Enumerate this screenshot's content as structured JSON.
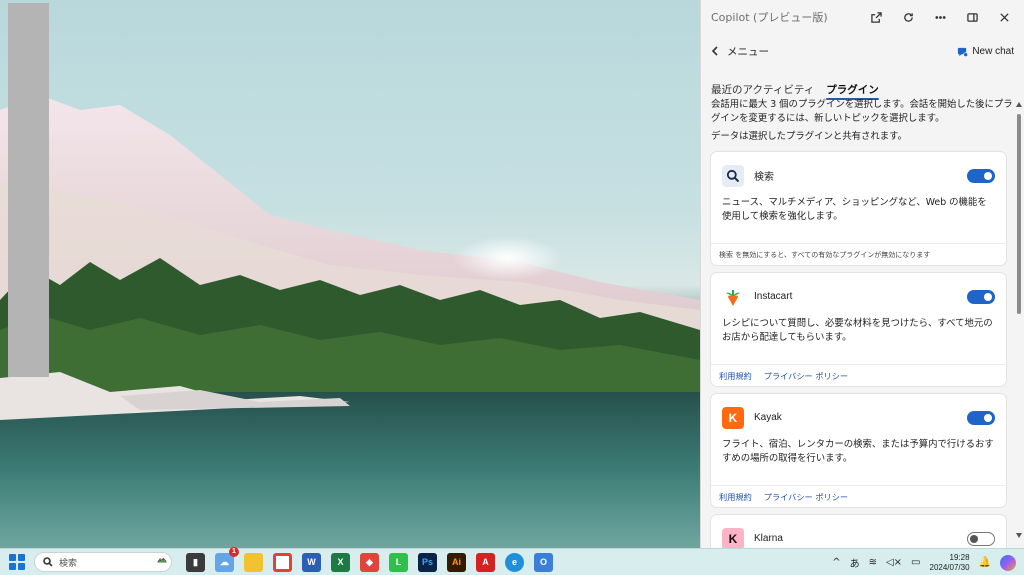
{
  "copilot": {
    "title": "Copilot (プレビュー版)",
    "back_label": "メニュー",
    "new_chat_label": "New chat",
    "tabs": [
      {
        "label": "最近のアクティビティ",
        "active": false
      },
      {
        "label": "プラグイン",
        "active": true
      }
    ],
    "intro": [
      "会話用に最大 3 個のプラグインを選択します。会話を開始した後にプラグインを変更するには、新しいトピックを選択します。",
      "データは選択したプラグインと共有されます。"
    ],
    "plugins": [
      {
        "name": "検索",
        "enabled": true,
        "description": "ニュース、マルチメディア、ショッピングなど、Web の機能を使用して検索を強化します。",
        "footer_note": "検索 を無効にすると、すべての有効なプラグインが無効になります"
      },
      {
        "name": "Instacart",
        "enabled": true,
        "description": "レシピについて質問し、必要な材料を見つけたら、すべて地元のお店から配達してもらいます。",
        "terms_link": "利用規約",
        "privacy_link": "プライバシー ポリシー"
      },
      {
        "name": "Kayak",
        "enabled": true,
        "description": "フライト、宿泊、レンタカーの検索、または予算内で行けるおすすめの場所の取得を行います。",
        "terms_link": "利用規約",
        "privacy_link": "プライバシー ポリシー"
      },
      {
        "name": "Klarna",
        "enabled": false
      }
    ]
  },
  "taskbar": {
    "search_placeholder": "検索",
    "notification_count": "1",
    "ime_indicator": "あ",
    "time": "19:28",
    "date": "2024/07/30"
  },
  "colors": {
    "accent": "#1f64c8",
    "link": "#1f4fae",
    "panel_bg": "#f4f4f4",
    "taskbar_bg": "#d8eeee"
  }
}
